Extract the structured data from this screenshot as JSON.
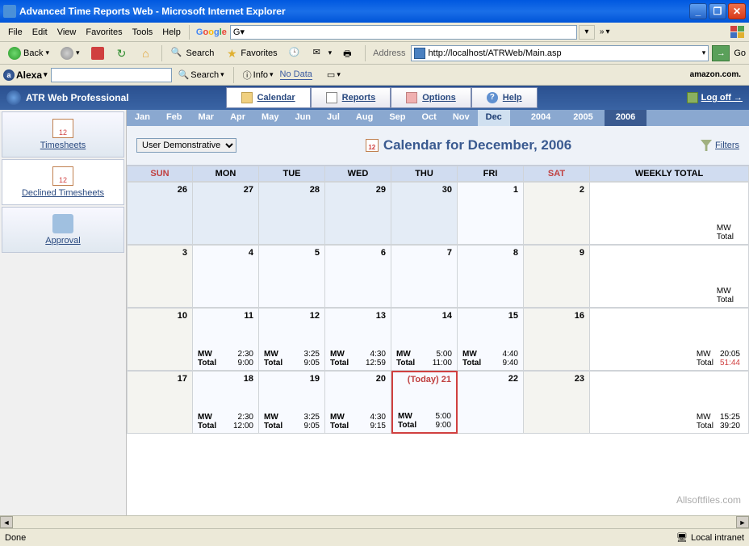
{
  "window": {
    "title": "Advanced Time Reports Web - Microsoft Internet Explorer"
  },
  "menubar": {
    "file": "File",
    "edit": "Edit",
    "view": "View",
    "favorites": "Favorites",
    "tools": "Tools",
    "help": "Help",
    "google": "Google",
    "g_prefix": "G"
  },
  "toolbar": {
    "back": "Back",
    "search": "Search",
    "favorites": "Favorites",
    "address_label": "Address",
    "url": "http://localhost/ATRWeb/Main.asp",
    "go": "Go"
  },
  "alexa": {
    "brand": "Alexa",
    "search": "Search",
    "info": "Info",
    "nodata": "No Data",
    "amazon": "amazon.com."
  },
  "app": {
    "title": "ATR Web Professional",
    "tab_calendar": "Calendar",
    "tab_reports": "Reports",
    "tab_options": "Options",
    "tab_help": "Help",
    "logoff": "Log off →"
  },
  "monthbar": {
    "months": [
      "Jan",
      "Feb",
      "Mar",
      "Apr",
      "May",
      "Jun",
      "Jul",
      "Aug",
      "Sep",
      "Oct",
      "Nov",
      "Dec"
    ],
    "active_month": 11,
    "years": [
      "2004",
      "2005",
      "2006"
    ],
    "active_year": 2
  },
  "cal_header": {
    "user_select": "User Demonstrative",
    "title": "Calendar for December, 2006",
    "filters": "Filters"
  },
  "sidebar": {
    "timesheets": "Timesheets",
    "declined": "Declined Timesheets",
    "approval": "Approval"
  },
  "dayheaders": [
    "SUN",
    "MON",
    "TUE",
    "WED",
    "THU",
    "FRI",
    "SAT",
    "WEEKLY TOTAL"
  ],
  "weeks": [
    {
      "days": [
        {
          "n": "26",
          "prev": true
        },
        {
          "n": "27",
          "prev": true
        },
        {
          "n": "28",
          "prev": true
        },
        {
          "n": "29",
          "prev": true
        },
        {
          "n": "30",
          "prev": true
        },
        {
          "n": "1"
        },
        {
          "n": "2"
        }
      ],
      "total": {
        "mw": "",
        "total": ""
      },
      "labels_only": true
    },
    {
      "days": [
        {
          "n": "3"
        },
        {
          "n": "4"
        },
        {
          "n": "5"
        },
        {
          "n": "6"
        },
        {
          "n": "7"
        },
        {
          "n": "8"
        },
        {
          "n": "9"
        }
      ],
      "total": {
        "mw": "",
        "total": ""
      },
      "labels_only": true
    },
    {
      "days": [
        {
          "n": "10"
        },
        {
          "n": "11",
          "mw": "2:30",
          "t": "9:00"
        },
        {
          "n": "12",
          "mw": "3:25",
          "t": "9:05"
        },
        {
          "n": "13",
          "mw": "4:30",
          "t": "12:59"
        },
        {
          "n": "14",
          "mw": "5:00",
          "t": "11:00"
        },
        {
          "n": "15",
          "mw": "4:40",
          "t": "9:40"
        },
        {
          "n": "16"
        }
      ],
      "total": {
        "mw": "20:05",
        "total": "51:44",
        "total_red": true
      }
    },
    {
      "days": [
        {
          "n": "17"
        },
        {
          "n": "18",
          "mw": "2:30",
          "t": "12:00"
        },
        {
          "n": "19",
          "mw": "3:25",
          "t": "9:05"
        },
        {
          "n": "20",
          "mw": "4:30",
          "t": "9:15"
        },
        {
          "n": "21",
          "mw": "5:00",
          "t": "9:00",
          "today": true,
          "today_label": "(Today)"
        },
        {
          "n": "22"
        },
        {
          "n": "23"
        }
      ],
      "total": {
        "mw": "15:25",
        "total": "39:20"
      }
    }
  ],
  "labels": {
    "mw": "MW",
    "total": "Total"
  },
  "statusbar": {
    "status": "Done",
    "zone": "Local intranet"
  },
  "watermark": "Allsoftfiles.com"
}
